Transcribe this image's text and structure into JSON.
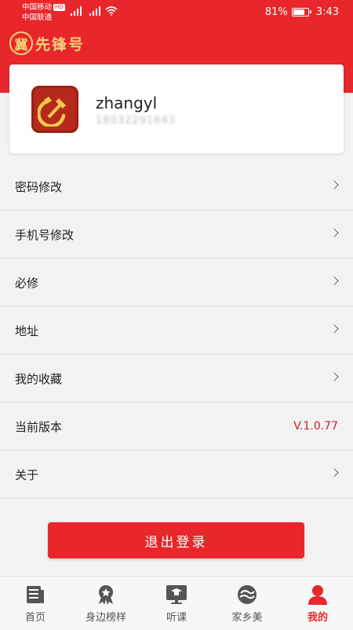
{
  "status_bar": {
    "carrier1": "中国移动",
    "hd_badge": "HD",
    "carrier2": "中国联通",
    "battery_level": 0.81,
    "battery_text": "81%",
    "time": "3:43"
  },
  "header": {
    "logo_mark": "冀",
    "logo_text": "先锋号"
  },
  "profile": {
    "username": "zhangyl",
    "phone": "18032291643"
  },
  "menu": {
    "items": [
      {
        "label": "密码修改"
      },
      {
        "label": "手机号修改"
      },
      {
        "label": "必修"
      },
      {
        "label": "地址"
      },
      {
        "label": "我的收藏"
      },
      {
        "label": "当前版本",
        "value": "V.1.0.77"
      },
      {
        "label": "关于"
      }
    ]
  },
  "logout_label": "退出登录",
  "tabs": [
    {
      "label": "首页",
      "icon": "news-icon"
    },
    {
      "label": "身边榜样",
      "icon": "medal-icon"
    },
    {
      "label": "听课",
      "icon": "classroom-icon"
    },
    {
      "label": "家乡美",
      "icon": "scenery-icon"
    },
    {
      "label": "我的",
      "icon": "user-icon",
      "active": true
    }
  ],
  "colors": {
    "primary": "#e8272c",
    "accent_gold": "#f6d27a",
    "version_text": "#c0252a"
  }
}
